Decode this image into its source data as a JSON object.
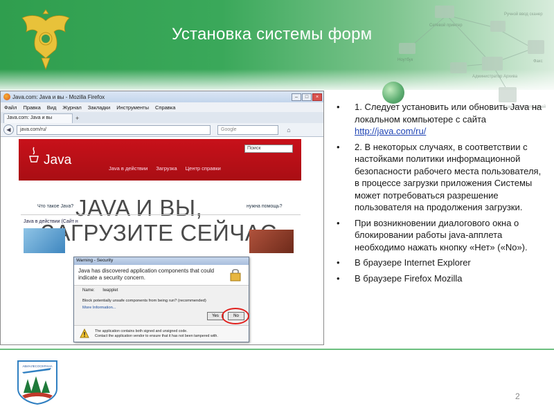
{
  "slide": {
    "title": "Установка системы форм",
    "page_number": "2"
  },
  "background_diagram": {
    "labels": [
      "Сетевой принтер",
      "Ручной ввод сканер",
      "Факс",
      "Ноутбук",
      "Администратор Архива",
      "Сканер с автоподачей"
    ]
  },
  "browser": {
    "window_title": "Java.com: Java и вы - Mozilla Firefox",
    "menu": [
      "Файл",
      "Правка",
      "Вид",
      "Журнал",
      "Закладки",
      "Инструменты",
      "Справка"
    ],
    "tab_label": "Java.com: Java и вы",
    "url": "java.com/ru/",
    "search_placeholder": "Google",
    "page": {
      "logo_text": "Java",
      "nav": [
        "Java в действии",
        "Загрузка",
        "Центр справки"
      ],
      "search_box": "Поиск",
      "hero_line1": "JAVA И ВЫ,",
      "hero_line2": "ЗАГРУЗИТЕ СЕЙЧАС",
      "link_left": "Что такое Java?",
      "link_right": "нужна помощь?",
      "section_heading": "Java в действии (Сайт н"
    }
  },
  "dialog": {
    "title": "Warning - Security",
    "heading": "Java has discovered application components that could indicate a security concern.",
    "name_label": "Name:",
    "name_value": "lwapplet",
    "question": "Block potentially unsafe components from being run? (recommended)",
    "more_info": "More Information...",
    "yes_label": "Yes",
    "no_label": "No",
    "footer1": "The application contains both signed and unsigned code.",
    "footer2": "Contact the application vendor to ensure that it has not been tampered with."
  },
  "instructions": {
    "item1_text": "1. Следует установить или обновить Java на локальном компьютере с сайта",
    "item1_link": "http://java.com/ru/",
    "item2": "2. В некоторых случаях, в соответствии с настойками политики информационной безопасности рабочего места пользователя, в процессе загрузки приложения Системы может потребоваться разрешение пользователя на продолжения загрузки.",
    "item3": " При возникновении диалогового окна о блокировании  работы java-апплета необходимо  нажать кнопку «Нет» («No»).",
    "item4": "В браузере Internet Explorer",
    "item5": "В браузере Firefox Mozilla"
  },
  "footer_logo_text": "АВИАЛЕСООХРАНА",
  "colors": {
    "header_green": "#2f9e4e",
    "java_red": "#c8111a",
    "highlight_circle": "#e0201d",
    "link_blue": "#1f44b4"
  }
}
